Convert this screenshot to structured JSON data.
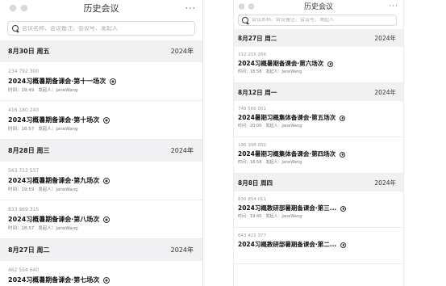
{
  "left": {
    "title": "历史会议",
    "more": "···",
    "search_placeholder": "会议名称、会议备注、会议号、发起人",
    "groups": [
      {
        "date": "8月30日 周五",
        "year": "2024年",
        "items": [
          {
            "id": "234 792 300",
            "title": "2024习概暑期备课会·第十一场次",
            "time": "时间：19:49",
            "host": "发起人：JaneWang"
          },
          {
            "id": "416 180 240",
            "title": "2024习概暑期备课会·第十场次",
            "time": "时间：18:57",
            "host": "发起人：JaneWang"
          }
        ]
      },
      {
        "date": "8月28日 周三",
        "year": "2024年",
        "items": [
          {
            "id": "563 713 537",
            "title": "2024习概暑期备课会·第九场次",
            "time": "时间：19:59",
            "host": "发起人：JaneWang"
          },
          {
            "id": "833 969 315",
            "title": "2024习概暑期备课会·第八场次",
            "time": "时间：18:57",
            "host": "发起人：JaneWang"
          }
        ]
      },
      {
        "date": "8月27日 周二",
        "year": "2024年",
        "items": [
          {
            "id": "462 554 640",
            "title": "2024习概暑期备课会·第七场次",
            "time": "",
            "host": ""
          }
        ]
      }
    ]
  },
  "right": {
    "title": "历史会议",
    "more": "···",
    "search_placeholder": "会议名称、会议备注、会议号、发起人",
    "groups": [
      {
        "date": "8月27日 周二",
        "year": "2024年",
        "items": [
          {
            "id": "112 215 266",
            "title": "2024习概暑期备课会·第六场次",
            "time": "时间：18:58",
            "host": "发起人：JaneWang"
          }
        ]
      },
      {
        "date": "8月12日 周一",
        "year": "2024年",
        "items": [
          {
            "id": "748 566 001",
            "title": "2024暑期习概集体备课会·第五场次",
            "time": "时间：20:00",
            "host": "发起人：JaneWang"
          },
          {
            "id": "186 398 050",
            "title": "2024暑期习概集体备课会·第四场次",
            "time": "时间：18:58",
            "host": "发起人：JaneWang"
          }
        ]
      },
      {
        "date": "8月8日 周四",
        "year": "2024年",
        "items": [
          {
            "id": "830 854 011",
            "title": "2024习概教研部暑期备课会·第三...",
            "time": "时间：19:40",
            "host": "发起人：JaneWang"
          },
          {
            "id": "643 422 377",
            "title": "2024习概教研部暑期备课会·第二...",
            "time": "",
            "host": ""
          }
        ]
      }
    ]
  }
}
